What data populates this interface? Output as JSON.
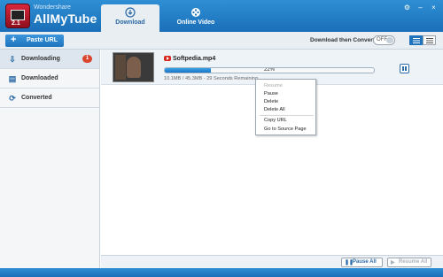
{
  "app": {
    "brand_small": "Wondershare",
    "brand_name": "AllMyTube",
    "logo_number": "2.1"
  },
  "tabs": [
    {
      "label": "Download",
      "icon": "download-circle-icon",
      "active": true
    },
    {
      "label": "Online Video",
      "icon": "film-reel-icon",
      "active": false
    }
  ],
  "window_controls": {
    "settings_icon": "gear-icon",
    "minimize": "–",
    "close": "×"
  },
  "toolbar": {
    "paste_url_label": "Paste URL",
    "download_then_convert_label": "Download then Convert",
    "toggle_state": "OFF"
  },
  "sidebar": {
    "items": [
      {
        "label": "Downloading",
        "icon": "download-tray-icon",
        "badge": "1",
        "active": true
      },
      {
        "label": "Downloaded",
        "icon": "downloaded-stack-icon",
        "active": false
      },
      {
        "label": "Converted",
        "icon": "convert-cycle-icon",
        "active": false
      }
    ]
  },
  "download_item": {
    "source_icon": "youtube-icon",
    "filename": "Softpedia.mp4",
    "progress_percent": 22,
    "progress_text": "22%",
    "status": "10.1MB / 45.3MB - 29 Seconds Remaining"
  },
  "context_menu": {
    "items": [
      {
        "label": "Resume",
        "disabled": true
      },
      {
        "label": "Pause",
        "disabled": false
      },
      {
        "label": "Delete",
        "disabled": false
      },
      {
        "label": "Delete All",
        "disabled": false
      },
      {
        "label": "Copy URL",
        "disabled": false
      },
      {
        "label": "Go to Source Page",
        "disabled": false
      }
    ]
  },
  "footer": {
    "pause_all_label": "Pause All",
    "resume_all_label": "Resume All"
  },
  "colors": {
    "accent": "#1f74bd",
    "badge": "#d9452f",
    "youtube": "#d8281e"
  }
}
